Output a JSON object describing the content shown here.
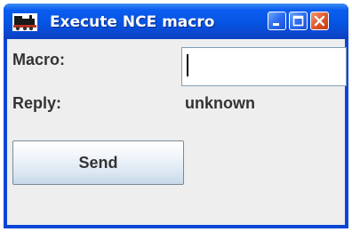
{
  "window": {
    "title": "Execute NCE macro",
    "icons": {
      "app": "train-icon",
      "minimize": "minimize-icon",
      "maximize": "maximize-icon",
      "close": "close-icon"
    },
    "colors": {
      "titlebar": "#0554e3",
      "close_button": "#e05a2a",
      "content_bg": "#eeeeee"
    }
  },
  "form": {
    "macro_label": "Macro:",
    "macro_value": "",
    "reply_label": "Reply:",
    "reply_value": "unknown",
    "send_label": "Send"
  }
}
